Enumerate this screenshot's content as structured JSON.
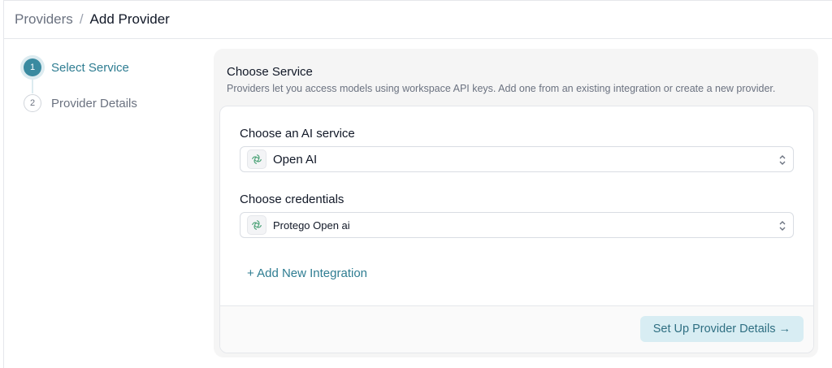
{
  "breadcrumb": {
    "parent": "Providers",
    "separator": "/",
    "current": "Add Provider"
  },
  "steps": [
    {
      "number": "1",
      "label": "Select Service",
      "state": "active"
    },
    {
      "number": "2",
      "label": "Provider Details",
      "state": "inactive"
    }
  ],
  "panel": {
    "title": "Choose Service",
    "description": "Providers let you access models using workspace API keys. Add one from an existing integration or create a new provider."
  },
  "form": {
    "service_label": "Choose an AI service",
    "service_value": "Open AI",
    "credentials_label": "Choose credentials",
    "credentials_value": "Protego Open ai",
    "add_integration": "+ Add New Integration",
    "submit": "Set Up Provider Details →"
  },
  "icons": {
    "service": "openai-icon",
    "credentials": "openai-icon",
    "select_toggle": "chevron-up-down-icon"
  },
  "colors": {
    "accent": "#3a8aa0",
    "accent_text": "#2f7d92",
    "button_bg": "#d8edf3"
  }
}
